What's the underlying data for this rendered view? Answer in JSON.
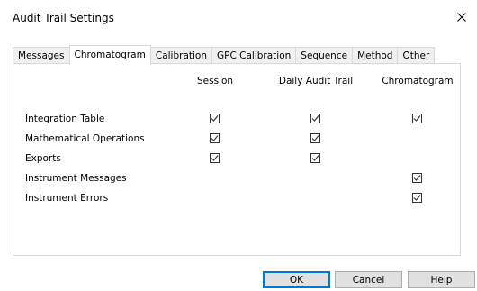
{
  "window": {
    "title": "Audit Trail Settings",
    "close_icon": "close-icon"
  },
  "tabs": [
    {
      "label": "Messages",
      "active": false
    },
    {
      "label": "Chromatogram",
      "active": true
    },
    {
      "label": "Calibration",
      "active": false
    },
    {
      "label": "GPC Calibration",
      "active": false
    },
    {
      "label": "Sequence",
      "active": false
    },
    {
      "label": "Method",
      "active": false
    },
    {
      "label": "Other",
      "active": false
    }
  ],
  "columns": [
    "Session",
    "Daily Audit Trail",
    "Chromatogram"
  ],
  "rows": [
    {
      "label": "Integration Table",
      "checks": [
        true,
        true,
        true
      ]
    },
    {
      "label": "Mathematical Operations",
      "checks": [
        true,
        true,
        null
      ]
    },
    {
      "label": "Exports",
      "checks": [
        true,
        true,
        null
      ]
    },
    {
      "label": "Instrument Messages",
      "checks": [
        null,
        null,
        true
      ]
    },
    {
      "label": "Instrument Errors",
      "checks": [
        null,
        null,
        true
      ]
    }
  ],
  "buttons": {
    "ok": "OK",
    "cancel": "Cancel",
    "help": "Help"
  },
  "colors": {
    "accent": "#0078d7",
    "check": "#333333"
  }
}
